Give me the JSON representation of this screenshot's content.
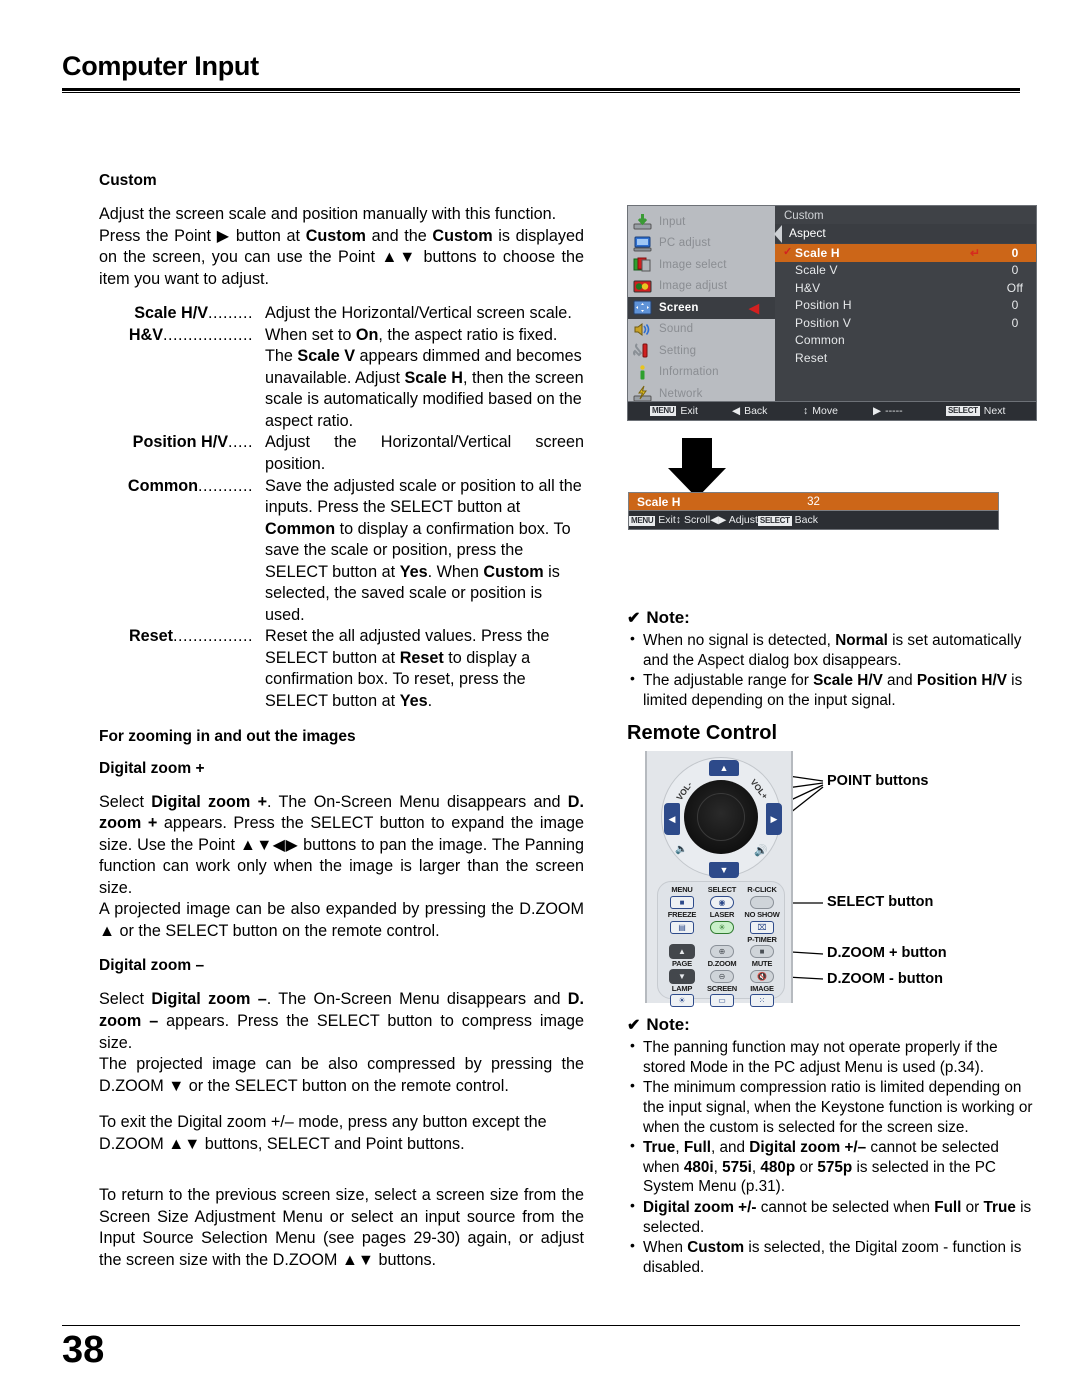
{
  "header": {
    "title": "Computer Input"
  },
  "left": {
    "section_title": "Custom",
    "intro_p1": "Adjust the screen scale and position manually with this function.",
    "intro_p2_a": "Press the Point ",
    "intro_p2_arrow": "▶",
    "intro_p2_b": " button at ",
    "intro_p2_custom1": "Custom",
    "intro_p2_c": " and the ",
    "intro_p2_custom2": "Custom",
    "intro_p2_d": " is displayed on the screen, you can use the Point ",
    "intro_p2_ud": "▲▼",
    "intro_p2_e": " buttons to choose the item you want to adjust.",
    "definitions": [
      {
        "term": "Scale H/V",
        "dots": ".........",
        "desc": "Adjust the Horizontal/Vertical screen scale."
      },
      {
        "term": "H&V",
        "dots": "..................",
        "desc_a": "When set to ",
        "b1": "On",
        "desc_b": ", the aspect ratio is fixed. The ",
        "b2": "Scale V",
        "desc_c": " appears dimmed and becomes unavailable. Adjust ",
        "b3": "Scale H",
        "desc_d": ", then the screen scale is automatically modified based on the aspect ratio."
      },
      {
        "term": "Position H/V",
        "dots": ".....",
        "desc": "Adjust the Horizontal/Vertical screen position."
      },
      {
        "term": "Common",
        "dots": "...........",
        "desc_a": "Save the adjusted scale or position to all the inputs. Press the SELECT button at ",
        "b1": "Common",
        "desc_b": " to display a confirmation box. To save the scale or position, press the SELECT button at ",
        "b2": "Yes",
        "desc_c": ". When ",
        "b3": "Custom",
        "desc_d": " is selected, the saved scale or position is used."
      },
      {
        "term": "Reset",
        "dots": "................",
        "desc_a": "Reset the all adjusted values. Press the SELECT button at ",
        "b1": "Reset",
        "desc_b": " to display a confirmation box. To reset, press the SELECT button at ",
        "b2": "Yes",
        "desc_c": "."
      }
    ],
    "zoom_heading": "For zooming in and out the images",
    "dzoom_plus_heading": "Digital zoom +",
    "dzoom_plus_p1_a": "Select ",
    "dzoom_plus_b1": "Digital zoom +",
    "dzoom_plus_p1_b": ". The On-Screen Menu disappears and ",
    "dzoom_plus_b2": "D. zoom +",
    "dzoom_plus_p1_c": " appears. Press the SELECT button to expand the image size. Use the Point ",
    "dzoom_plus_arrows": "▲▼◀▶",
    "dzoom_plus_p1_d": " buttons to pan the image. The Panning function can work only when the image is larger than the screen size.",
    "dzoom_plus_p2_a": "A projected image can be also expanded by pressing the D.ZOOM ",
    "dzoom_plus_p2_arrow": "▲",
    "dzoom_plus_p2_b": " or the SELECT button on the remote control.",
    "dzoom_minus_heading": "Digital zoom –",
    "dzoom_minus_p1_a": "Select ",
    "dzoom_minus_b1": "Digital zoom –",
    "dzoom_minus_p1_b": ". The On-Screen Menu disappears and ",
    "dzoom_minus_b2": "D. zoom –",
    "dzoom_minus_p1_c": " appears. Press the SELECT button to compress image size.",
    "dzoom_minus_p2_a": "The projected image can be also compressed by pressing the D.ZOOM ",
    "dzoom_minus_p2_arrow": "▼",
    "dzoom_minus_p2_b": " or the SELECT button on the remote control.",
    "exit_p_a": "To exit the Digital zoom +/– mode, press any button except the D.ZOOM  ",
    "exit_p_arrows": "▲▼",
    "exit_p_b": " buttons, SELECT and Point buttons.",
    "return_p_a": "To return to the previous screen size, select a screen size from the Screen Size Adjustment Menu or select an input source from the Input Source Selection Menu (see pages 29-30) again, or adjust the screen size with the D.ZOOM ",
    "return_p_arrows": "▲▼",
    "return_p_b": " buttons."
  },
  "osd": {
    "sidebar": [
      {
        "label": "Input",
        "icon": "input-icon",
        "active": false
      },
      {
        "label": "PC adjust",
        "icon": "monitor-icon",
        "active": false
      },
      {
        "label": "Image select",
        "icon": "image-select-icon",
        "active": false
      },
      {
        "label": "Image adjust",
        "icon": "image-adjust-icon",
        "active": false
      },
      {
        "label": "Screen",
        "icon": "screen-icon",
        "active": true
      },
      {
        "label": "Sound",
        "icon": "speaker-icon",
        "active": false
      },
      {
        "label": "Setting",
        "icon": "tools-icon",
        "active": false
      },
      {
        "label": "Information",
        "icon": "info-icon",
        "active": false
      },
      {
        "label": "Network",
        "icon": "network-icon",
        "active": false
      }
    ],
    "panel_title": "Custom",
    "aspect_label": "Aspect",
    "rows": [
      {
        "label": "Scale H",
        "value": "0",
        "selected": true,
        "check": "✓",
        "enter": "↵"
      },
      {
        "label": "Scale V",
        "value": "0",
        "selected": false,
        "check": "",
        "enter": ""
      },
      {
        "label": "H&V",
        "value": "Off",
        "selected": false,
        "check": "",
        "enter": ""
      },
      {
        "label": "Position H",
        "value": "0",
        "selected": false,
        "check": "",
        "enter": ""
      },
      {
        "label": "Position V",
        "value": "0",
        "selected": false,
        "check": "",
        "enter": ""
      },
      {
        "label": "Common",
        "value": "",
        "selected": false,
        "check": "",
        "enter": ""
      },
      {
        "label": "Reset",
        "value": "",
        "selected": false,
        "check": "",
        "enter": ""
      }
    ],
    "footer": {
      "exit_key": "MENU",
      "exit_label": "Exit",
      "back_icon": "◀",
      "back_label": "Back",
      "move_icon": "↕",
      "move_label": "Move",
      "dash_icon": "▶",
      "dash_label": "-----",
      "next_key": "SELECT",
      "next_label": "Next"
    },
    "accent_orange": "#cc6618",
    "accent_red": "#d32020"
  },
  "scalebar": {
    "label": "Scale H",
    "value": "32",
    "footer": {
      "exit_key": "MENU",
      "exit_label": "Exit",
      "scroll_icon": "↕",
      "scroll_label": "Scroll",
      "adjust_icon": "◀▶",
      "adjust_label": "Adjust",
      "back_key": "SELECT",
      "back_label": "Back"
    }
  },
  "note1": {
    "title": "Note:",
    "check": "✔",
    "items": [
      {
        "a": "When no signal is detected, ",
        "b1": "Normal",
        "c": " is set automatically and the Aspect dialog box disappears."
      },
      {
        "a": "The adjustable range for ",
        "b1": "Scale H/V",
        "c": " and ",
        "b2": "Position H/V",
        "d": " is limited depending on the input signal."
      }
    ]
  },
  "remote_control": {
    "title": "Remote Control",
    "vol_left": "VOL-",
    "vol_right": "VOL+",
    "buttons": [
      {
        "label": "MENU",
        "glyph": "■"
      },
      {
        "label": "SELECT",
        "glyph": "◉"
      },
      {
        "label": "R-CLICK",
        "glyph": ""
      },
      {
        "label": "FREEZE",
        "glyph": "▤"
      },
      {
        "label": "LASER",
        "glyph": "✳"
      },
      {
        "label": "NO SHOW",
        "glyph": "⌧"
      },
      {
        "label": "P-TIMER",
        "glyph": ""
      },
      {
        "label": "PAGE",
        "glyph": ""
      },
      {
        "label": "D.ZOOM",
        "glyph": ""
      },
      {
        "label": "MUTE",
        "glyph": ""
      },
      {
        "label": "LAMP",
        "glyph": "☀"
      },
      {
        "label": "SCREEN",
        "glyph": "▭"
      },
      {
        "label": "IMAGE",
        "glyph": "⁙"
      }
    ],
    "callouts": [
      {
        "label": "POINT buttons"
      },
      {
        "label": "SELECT button"
      },
      {
        "label": "D.ZOOM + button"
      },
      {
        "label": "D.ZOOM - button"
      }
    ]
  },
  "note2": {
    "title": "Note:",
    "check": "✔",
    "items": [
      {
        "a": "The panning function may not operate properly if the stored Mode in the PC adjust Menu is used (p.34)."
      },
      {
        "a": "The minimum compression ratio is limited depending on the input signal, when the Keystone function is working or when the custom is selected for the screen size."
      },
      {
        "b1": "True",
        "a": ", ",
        "b2": "Full",
        "c": ", and ",
        "b3": "Digital zoom +/–",
        "d": " cannot be selected when ",
        "b4": "480i",
        "e": ", ",
        "b5": "575i",
        "f": ", ",
        "b6": "480p",
        "g": " or ",
        "b7": "575p",
        "h": " is selected in the PC System Menu (p.31)."
      },
      {
        "b1": "Digital zoom +/-",
        "a": " cannot be selected when ",
        "b2": "Full",
        "c": " or ",
        "b3": "True",
        "d": " is selected."
      },
      {
        "a": "When ",
        "b1": "Custom",
        "c": " is selected, the Digital zoom - function is disabled."
      }
    ]
  },
  "footer": {
    "page_number": "38"
  }
}
